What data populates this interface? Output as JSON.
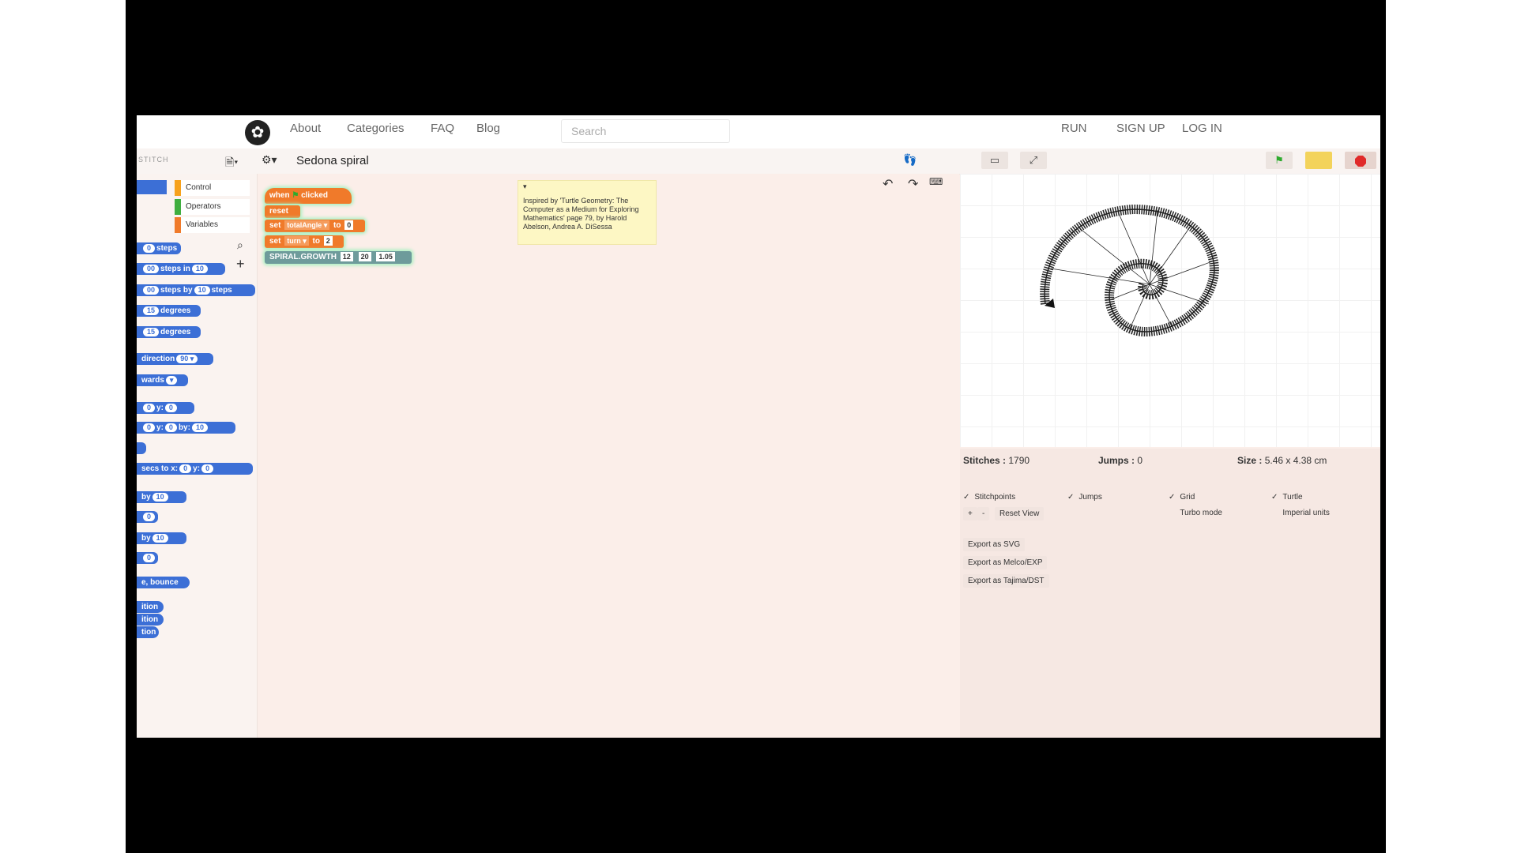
{
  "nav": {
    "links": [
      "About",
      "Categories",
      "FAQ",
      "Blog"
    ],
    "search_placeholder": "Search",
    "right": [
      "RUN",
      "SIGN UP",
      "LOG IN"
    ]
  },
  "toolbar": {
    "brand": "STITCH",
    "project_title": "Sedona spiral"
  },
  "palette": {
    "categories": [
      "Control",
      "Operators",
      "Variables"
    ],
    "category_colors": [
      "#f7a11b",
      "#3fae3f",
      "#f07a2a"
    ],
    "blocks": [
      {
        "t1": "steps"
      },
      {
        "a": "00",
        "t1": "steps in",
        "b": "10"
      },
      {
        "a": "00",
        "t1": "steps by",
        "b": "10",
        "t2": "steps"
      },
      {
        "a": "15",
        "t1": "degrees"
      },
      {
        "a": "15",
        "t1": "degrees"
      },
      {
        "t1": "direction",
        "b": "90 ▾"
      },
      {
        "t1": "wards",
        "b": "▾"
      },
      {
        "a": "0",
        "t1": "y:",
        "b": "0"
      },
      {
        "a": "0",
        "t1": "y:",
        "b": "0",
        "t2": "by:",
        "c": "10"
      },
      {
        "t1": "secs to x:",
        "b": "0",
        "t2": "y:",
        "c": "0"
      },
      {
        "t1": "by",
        "b": "10"
      },
      {
        "a": "0"
      },
      {
        "t1": "by",
        "b": "10"
      },
      {
        "a": "0"
      },
      {
        "t1": "e, bounce"
      },
      {
        "t1": "ition"
      },
      {
        "t1": "ition"
      },
      {
        "t1": "tion"
      }
    ]
  },
  "script": {
    "hat_label_1": "when",
    "hat_label_2": "clicked",
    "reset": "reset",
    "set1": {
      "label": "set",
      "var": "totalAngle ▾",
      "to": "to",
      "val": "0"
    },
    "set2": {
      "label": "set",
      "var": "turn ▾",
      "to": "to",
      "val": "2"
    },
    "spiral": {
      "label": "SPIRAL.GROWTH",
      "v1": "12",
      "v2": "20",
      "v3": "1.05"
    },
    "comment": "Inspired by 'Turtle Geometry: The Computer as a Medium for Exploring Mathematics' page 79, by Harold Abelson, Andrea A. DiSessa"
  },
  "stats": {
    "stitches_label": "Stitches :",
    "stitches": "1790",
    "jumps_label": "Jumps :",
    "jumps": "0",
    "size_label": "Size :",
    "size": "5.46 x 4.38 cm"
  },
  "options": {
    "checked": [
      "Stitchpoints",
      "Jumps",
      "Grid",
      "Turtle"
    ],
    "unchecked": [
      "Turbo mode",
      "Imperial units"
    ],
    "reset_view": "Reset View",
    "export": [
      "Export as SVG",
      "Export as Melco/EXP",
      "Export as Tajima/DST"
    ]
  },
  "colors": {
    "accent_orange": "#f07a2a",
    "motion_blue": "#3c6fd6",
    "flag_green": "#2eaa2e",
    "pause_yellow": "#f3d35b",
    "stop_red": "#e02a2a"
  }
}
